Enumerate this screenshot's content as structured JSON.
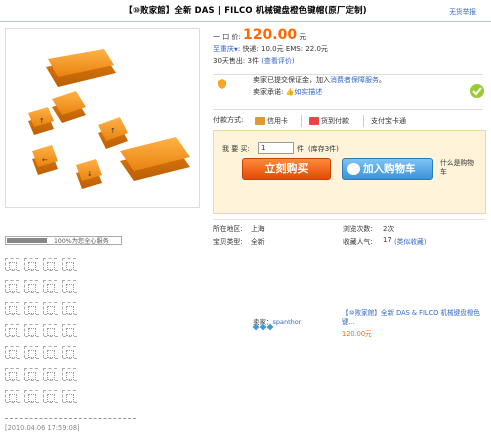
{
  "title_bar": {
    "title": "【⑩败家館】全新 DAS | FILCO 机械键盘橙色键帽(原厂定制)",
    "report_link": "无货举报"
  },
  "price": {
    "label": "一 口 价:",
    "value": "120.00",
    "unit": "元"
  },
  "shipping": {
    "destination": "至重庆",
    "arrow": "▼",
    "text": ": 快递: 10.0元  EMS: 22.0元"
  },
  "sales": {
    "label": "30天售出:",
    "count": "3件",
    "review_link": "(查看评价)"
  },
  "seller_guarantee": {
    "line1": "卖家已提交保证金，加入",
    "line1_link": "消费者保障服务",
    "line1_end": "。",
    "line2_label": "卖家承诺:",
    "line2_link": "如实描述"
  },
  "payment": {
    "label": "付款方式:",
    "methods": [
      "信用卡",
      "货到付款",
      "支付宝卡通"
    ],
    "colors": {
      "credit": "#d93",
      "cod": "#e44",
      "alipay": "#1a7dc4"
    }
  },
  "buy": {
    "qty_label": "我 要 买:",
    "qty_value": "1",
    "qty_unit": "件",
    "stock": "(库存3件)",
    "buy_button": "立刻购买",
    "cart_button": "加入购物车",
    "what_cart": "什么是购物车"
  },
  "meta": {
    "location_label": "所在地区:",
    "location": "上海",
    "views_label": "浏览次数:",
    "views": "2次",
    "type_label": "宝贝类型:",
    "type": "全新",
    "fav_label": "收藏人气:",
    "fav": "17",
    "fav_link": "(类似收藏)"
  },
  "service": {
    "text": "100%为您全心服务",
    "progress": 1.0
  },
  "bottom": {
    "seller_label": "卖家：",
    "seller_name": "spanthor"
  },
  "recommend": {
    "title": "【⑩败家館】全新 DAS & FILCO 机械键盘橙色键...",
    "price": "120.00",
    "unit": "元"
  },
  "footer": {
    "timestamp": "[2010.04.06 17:59:08]"
  }
}
